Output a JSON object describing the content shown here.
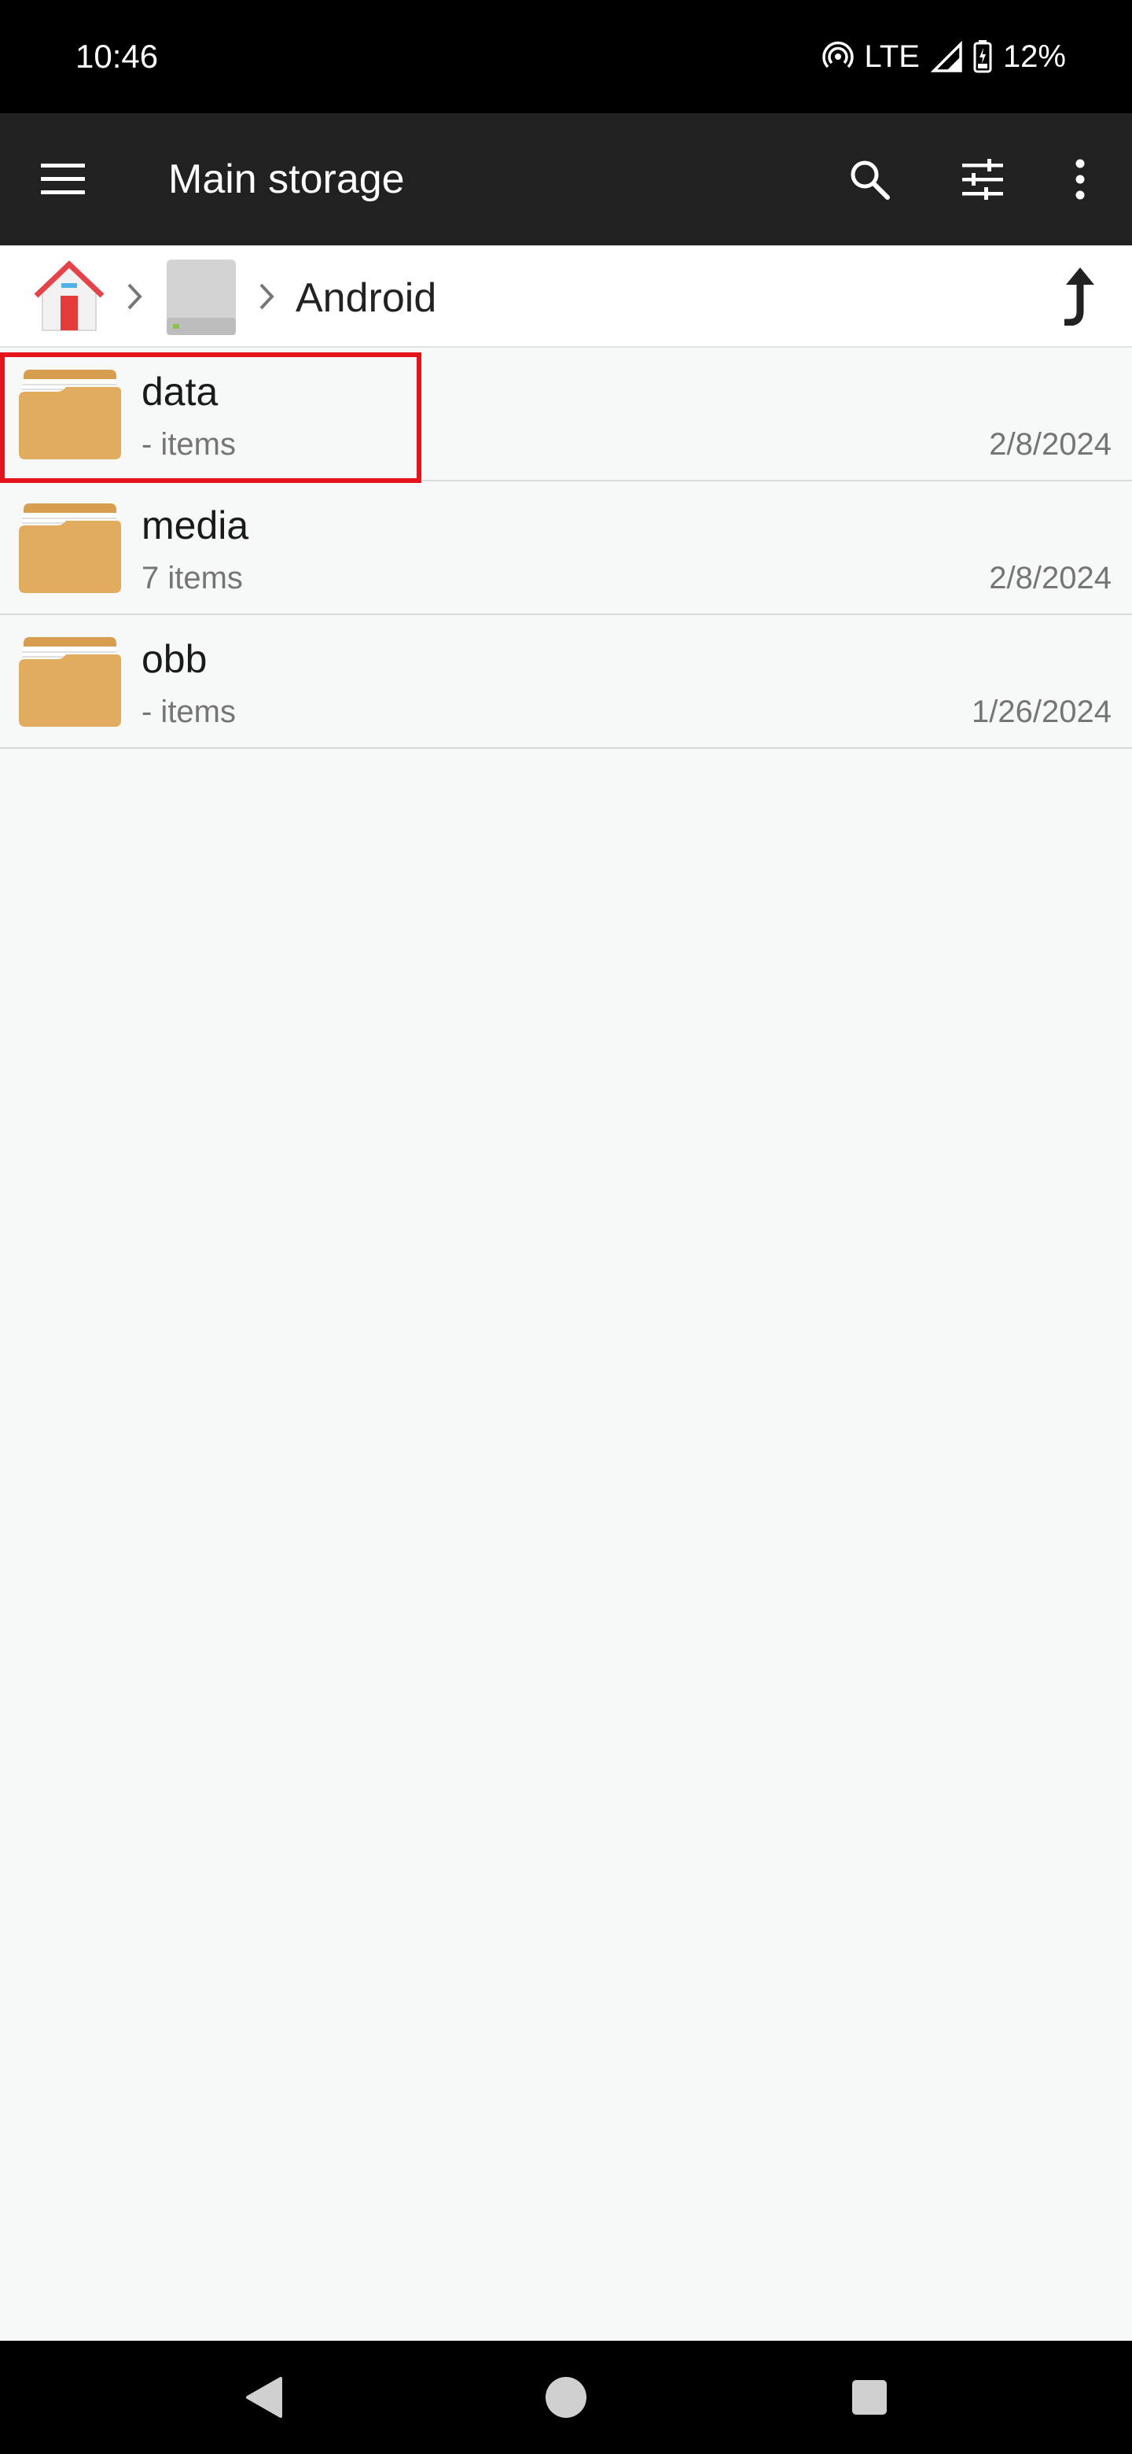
{
  "status_bar": {
    "time": "10:46",
    "network": "LTE",
    "battery": "12%",
    "icons": [
      "hotspot-icon",
      "signal-icon",
      "battery-icon"
    ]
  },
  "app_bar": {
    "title": "Main storage",
    "icons": [
      "menu-icon",
      "search-icon",
      "filter-icon",
      "more-vert-icon"
    ]
  },
  "breadcrumb": {
    "items": [
      {
        "icon": "home-icon"
      },
      {
        "icon": "drive-icon"
      }
    ],
    "current": "Android",
    "up_icon": "up-arrow-icon"
  },
  "files": [
    {
      "name": "data",
      "count": "- items",
      "date": "2/8/2024",
      "highlighted": true
    },
    {
      "name": "media",
      "count": "7 items",
      "date": "2/8/2024",
      "highlighted": false
    },
    {
      "name": "obb",
      "count": "- items",
      "date": "1/26/2024",
      "highlighted": false
    }
  ],
  "colors": {
    "app_bar": "#212121",
    "folder": "#e2ac5e",
    "highlight": "#e5131b",
    "background": "#f7f8f8"
  },
  "nav_bar": {
    "icons": [
      "back-icon",
      "home-circle-icon",
      "recents-icon"
    ]
  }
}
